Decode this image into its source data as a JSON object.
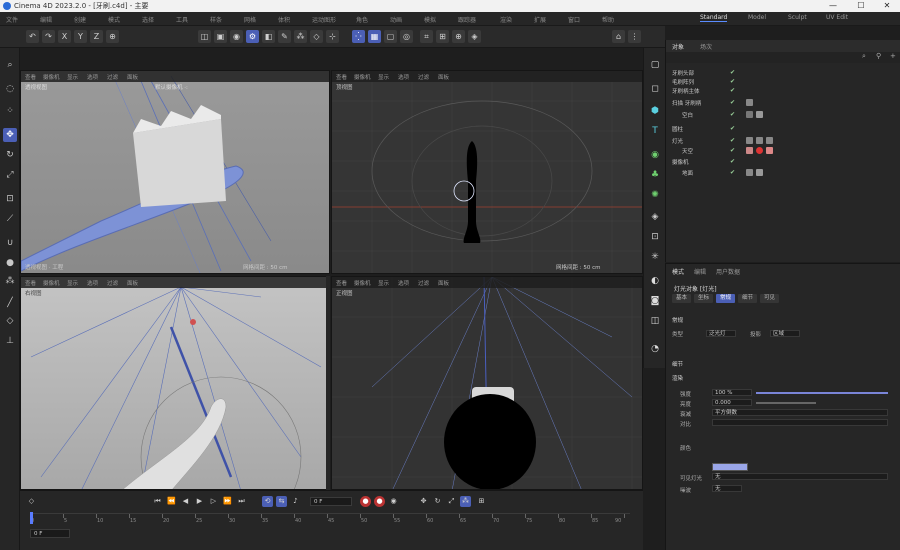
{
  "window": {
    "title": "Cinema 4D 2023.2.0 - [牙刷.c4d] - 主要",
    "minimize": "—",
    "maximize": "☐",
    "close": "✕"
  },
  "menu": {
    "items": [
      "文件",
      "编辑",
      "创建",
      "模式",
      "选择",
      "工具",
      "样条",
      "网格",
      "体积",
      "运动图形",
      "角色",
      "动画",
      "模拟",
      "跟踪器",
      "渲染",
      "扩展",
      "窗口",
      "帮助"
    ],
    "workspaces": [
      "Standard",
      "Model",
      "Sculpt",
      "UV Edit"
    ],
    "active_workspace": "Standard"
  },
  "toolbar": {
    "icons": [
      "undo-icon",
      "redo-icon",
      "move-icon",
      "scale-icon",
      "rotate-icon",
      "coord-icon",
      "cube-icon",
      "pen-icon",
      "array-icon",
      "subdivide-icon",
      "deformer-icon",
      "field-icon",
      "camera-icon",
      "light-icon",
      "render-region-icon",
      "render-view-icon",
      "render-icon",
      "points-icon",
      "edges-icon",
      "polygons-icon",
      "model-icon",
      "snap-icon",
      "workplane-icon",
      "axis-icon",
      "solo-icon",
      "lock-icon"
    ]
  },
  "viewports": {
    "perspective": {
      "head": [
        "查看",
        "摄像机",
        "显示",
        "选项",
        "过滤",
        "面板"
      ],
      "name": "透视视图",
      "camera": "默认摄像机 ·:",
      "footer_left": "透视视图 · 工程",
      "footer_right": "网格间距 : 50 cm"
    },
    "top": {
      "head": [
        "查看",
        "摄像机",
        "显示",
        "选项",
        "过滤",
        "面板"
      ],
      "name": "顶视图",
      "footer_right": "网格间距 : 50 cm"
    },
    "right": {
      "head": [
        "查看",
        "摄像机",
        "显示",
        "选项",
        "过滤",
        "面板"
      ],
      "name": "右视图"
    },
    "front": {
      "head": [
        "查看",
        "摄像机",
        "显示",
        "选项",
        "过滤",
        "面板"
      ],
      "name": "正视图"
    }
  },
  "timeline": {
    "frame_field": "0 F",
    "ticks": [
      "0",
      "5",
      "10",
      "15",
      "20",
      "25",
      "30",
      "35",
      "40",
      "45",
      "50",
      "55",
      "60",
      "65",
      "70",
      "75",
      "80",
      "85",
      "90"
    ],
    "start_field": "0 F"
  },
  "objects": {
    "tabs": [
      "对象",
      "场次"
    ],
    "rows": [
      {
        "name": "牙刷头部",
        "indent": 0
      },
      {
        "name": "毛刷阵列",
        "indent": 0
      },
      {
        "name": "牙刷柄主体",
        "indent": 0
      },
      {
        "name": "扫描 牙刷柄",
        "indent": 0
      },
      {
        "name": "空白",
        "indent": 1
      },
      {
        "name": "圆柱",
        "indent": 0
      },
      {
        "name": "灯光",
        "indent": 0
      },
      {
        "name": "天空",
        "indent": 0
      },
      {
        "name": "摄像机",
        "indent": 0
      },
      {
        "name": "地面",
        "indent": 0
      }
    ]
  },
  "attributes": {
    "tabs": [
      "模式",
      "编辑",
      "用户数据"
    ],
    "object_label": "灯光对象 [灯光]",
    "sub_tabs": [
      "基本",
      "坐标",
      "常规",
      "细节",
      "可见",
      "投影",
      "光度",
      "焦散",
      "噪波",
      "镜头光晕",
      "工程"
    ],
    "active_sub_tab": "常规",
    "section_general": "常规",
    "type_label": "类型",
    "type_value": "泛光灯",
    "shadow_label": "投影",
    "shadow_value": "区域",
    "color_label": "颜色",
    "intensity_label": "强度",
    "intensity_value": "100 %",
    "brightness_label": "亮度",
    "brightness_value": "0.000",
    "visibility_label": "可见灯光",
    "visibility_value": "无",
    "noise_label": "噪波",
    "noise_value": "无",
    "details_section": "细节",
    "render_section": "渲染",
    "contrast_label": "对比",
    "falloff_label": "衰减",
    "falloff_value": "平方倒数"
  }
}
